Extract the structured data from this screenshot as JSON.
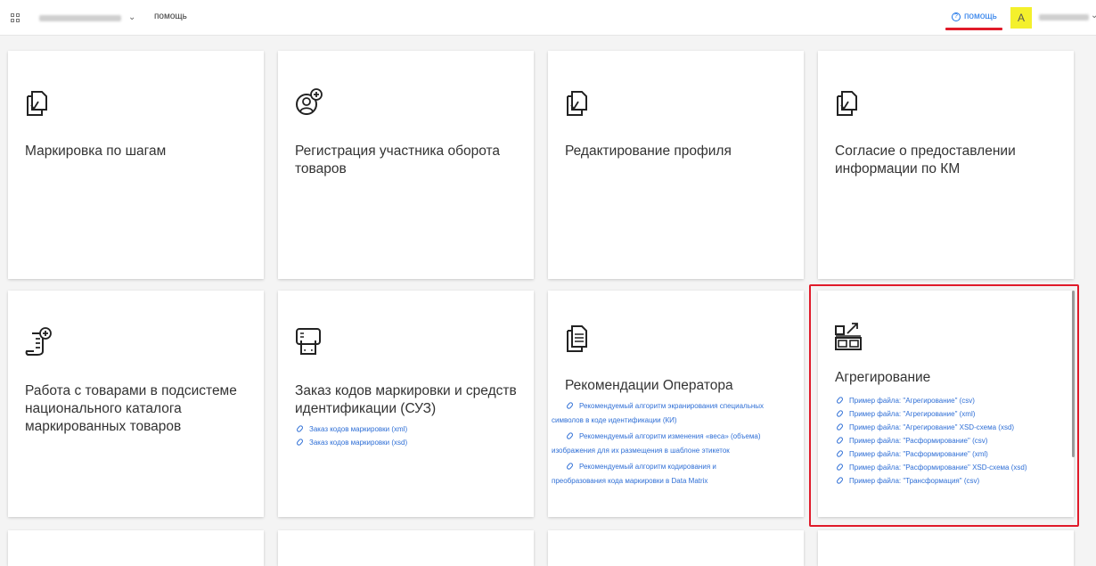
{
  "header": {
    "breadcrumb": "помощь",
    "help_label": "помощь",
    "help_glyph": "?",
    "avatar_letter": "А",
    "chevron": "⌄"
  },
  "cards": [
    {
      "title": "Маркировка по шагам",
      "icon": "document-check-icon"
    },
    {
      "title": "Регистрация участника оборота товаров",
      "icon": "user-add-icon"
    },
    {
      "title": "Редактирование профиля",
      "icon": "document-check-icon"
    },
    {
      "title": "Согласие о предоставлении информации по КМ",
      "icon": "document-check-icon"
    },
    {
      "title": "Работа с товарами в подсистеме национального каталога маркированных товаров",
      "icon": "scroll-add-icon"
    },
    {
      "title": "Заказ кодов маркировки и средств идентификации (СУЗ)",
      "icon": "printer-icon",
      "links": [
        "Заказ кодов маркировки (xml)",
        "Заказ кодов маркировки (xsd)"
      ]
    },
    {
      "title": "Рекомендации Оператора",
      "icon": "documents-icon",
      "links": [
        {
          "l1": "Рекомендуемый алгоритм экранирования специальных",
          "l2": "символов в коде идентификации (КИ)"
        },
        {
          "l1": "Рекомендуемый алгоритм изменения «веса» (объема)",
          "l2": "изображения для их размещения в шаблоне этикеток"
        },
        {
          "l1": "Рекомендуемый алгоритм кодирования и",
          "l2": "преобразования кода маркировки в Data Matrix"
        }
      ]
    },
    {
      "title": "Агрегирование",
      "icon": "aggregation-icon",
      "links": [
        "Пример файла: \"Агрегирование\" (csv)",
        "Пример файла: \"Агрегирование\" (xml)",
        "Пример файла: \"Агрегирование\" XSD-схема (xsd)",
        "Пример файла: \"Расформирование\" (csv)",
        "Пример файла: \"Расформирование\" (xml)",
        "Пример файла: \"Расформирование\" XSD-схема (xsd)",
        "Пример файла: \"Трансформация\" (csv)"
      ]
    }
  ]
}
